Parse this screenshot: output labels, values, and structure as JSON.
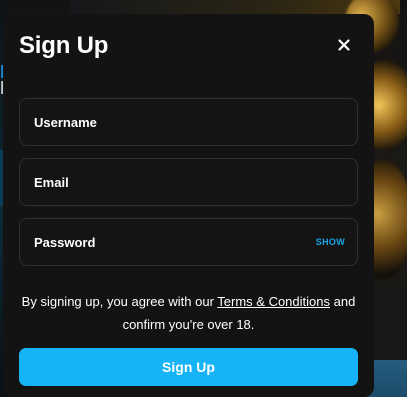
{
  "background": {
    "left_edge_text_1": "D",
    "left_edge_text_2": "R"
  },
  "modal": {
    "title": "Sign Up",
    "close_icon": "close-icon",
    "fields": {
      "username_placeholder": "Username",
      "email_placeholder": "Email",
      "password_placeholder": "Password",
      "password_toggle_label": "SHOW"
    },
    "consent": {
      "prefix": "By signing up, you agree with our ",
      "terms_link": "Terms & Conditions",
      "suffix": " and confirm you're over 18."
    },
    "submit_label": "Sign Up"
  },
  "colors": {
    "accent": "#16b4f7",
    "link_blue": "#19a6e8",
    "modal_bg": "#131313",
    "field_border": "#2f2f30"
  }
}
